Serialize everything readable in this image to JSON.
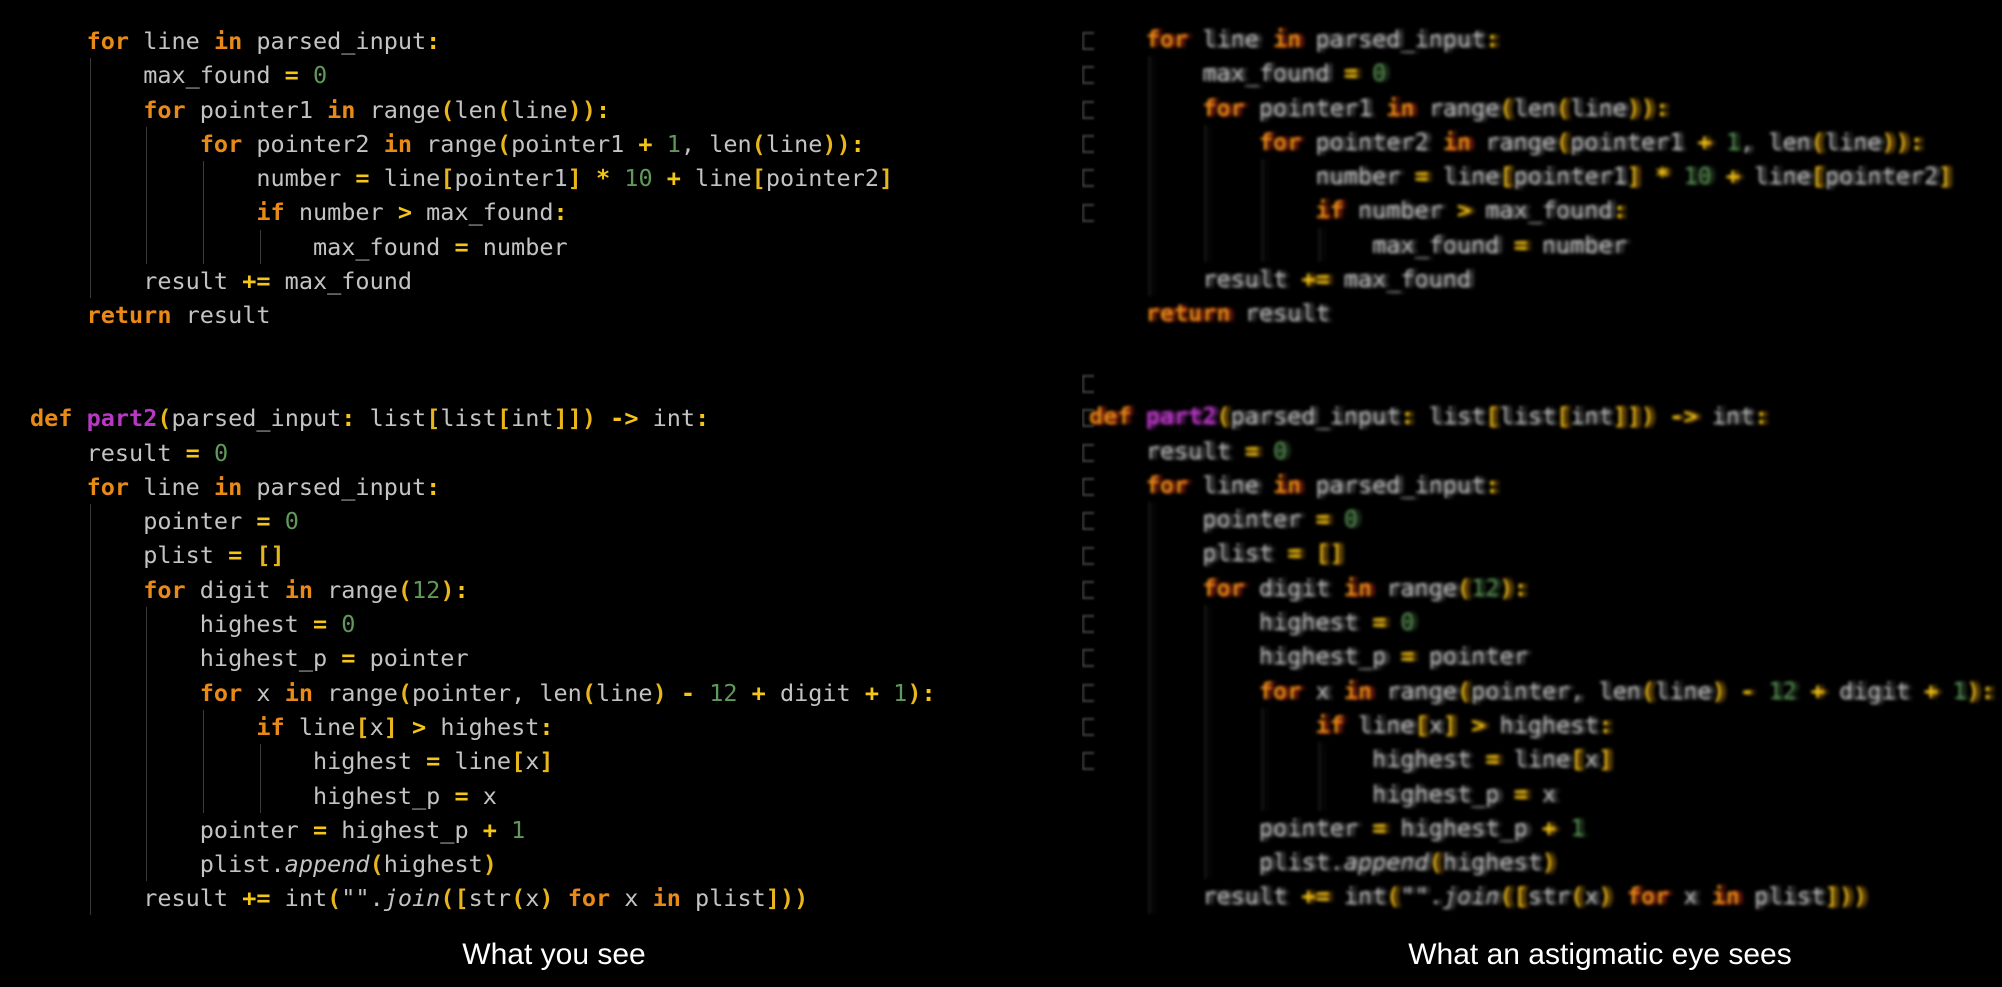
{
  "captions": {
    "left": "What you see",
    "right": "What an astigmatic eye sees"
  },
  "colors": {
    "background": "#000000",
    "default_text": "#c3c3c3",
    "keyword": "#e98a17",
    "operator": "#f5c518",
    "number": "#5f9a5a",
    "function_name": "#b838c4",
    "bracket": "#e8b51a",
    "indent_guide": "#3a3a3a"
  },
  "code_lines": [
    {
      "indent": 1,
      "tokens": [
        [
          "kw",
          "for"
        ],
        [
          "t",
          " line "
        ],
        [
          "kw",
          "in"
        ],
        [
          "t",
          " parsed_input"
        ],
        [
          "op",
          ":"
        ]
      ]
    },
    {
      "indent": 2,
      "tokens": [
        [
          "t",
          "max_found "
        ],
        [
          "op",
          "="
        ],
        [
          "t",
          " "
        ],
        [
          "num",
          "0"
        ]
      ]
    },
    {
      "indent": 2,
      "tokens": [
        [
          "kw",
          "for"
        ],
        [
          "t",
          " pointer1 "
        ],
        [
          "kw",
          "in"
        ],
        [
          "t",
          " range"
        ],
        [
          "br",
          "("
        ],
        [
          "t",
          "len"
        ],
        [
          "br",
          "("
        ],
        [
          "t",
          "line"
        ],
        [
          "br",
          "))"
        ],
        [
          "op",
          ":"
        ]
      ]
    },
    {
      "indent": 3,
      "tokens": [
        [
          "kw",
          "for"
        ],
        [
          "t",
          " pointer2 "
        ],
        [
          "kw",
          "in"
        ],
        [
          "t",
          " range"
        ],
        [
          "br",
          "("
        ],
        [
          "t",
          "pointer1 "
        ],
        [
          "op",
          "+"
        ],
        [
          "t",
          " "
        ],
        [
          "num",
          "1"
        ],
        [
          "t",
          ", len"
        ],
        [
          "br",
          "("
        ],
        [
          "t",
          "line"
        ],
        [
          "br",
          "))"
        ],
        [
          "op",
          ":"
        ]
      ]
    },
    {
      "indent": 4,
      "tokens": [
        [
          "t",
          "number "
        ],
        [
          "op",
          "="
        ],
        [
          "t",
          " line"
        ],
        [
          "br",
          "["
        ],
        [
          "t",
          "pointer1"
        ],
        [
          "br",
          "]"
        ],
        [
          "t",
          " "
        ],
        [
          "op",
          "*"
        ],
        [
          "t",
          " "
        ],
        [
          "num",
          "10"
        ],
        [
          "t",
          " "
        ],
        [
          "op",
          "+"
        ],
        [
          "t",
          " line"
        ],
        [
          "br",
          "["
        ],
        [
          "t",
          "pointer2"
        ],
        [
          "br",
          "]"
        ]
      ]
    },
    {
      "indent": 4,
      "tokens": [
        [
          "kw",
          "if"
        ],
        [
          "t",
          " number "
        ],
        [
          "op",
          ">"
        ],
        [
          "t",
          " max_found"
        ],
        [
          "op",
          ":"
        ]
      ]
    },
    {
      "indent": 5,
      "tokens": [
        [
          "t",
          "max_found "
        ],
        [
          "op",
          "="
        ],
        [
          "t",
          " number"
        ]
      ]
    },
    {
      "indent": 2,
      "tokens": [
        [
          "t",
          "result "
        ],
        [
          "op",
          "+="
        ],
        [
          "t",
          " max_found"
        ]
      ]
    },
    {
      "indent": 1,
      "tokens": [
        [
          "kw",
          "return"
        ],
        [
          "t",
          " result"
        ]
      ]
    },
    {
      "indent": 0,
      "tokens": []
    },
    {
      "indent": 0,
      "tokens": []
    },
    {
      "indent": 0,
      "tokens": [
        [
          "kw",
          "def"
        ],
        [
          "t",
          " "
        ],
        [
          "fn",
          "part2"
        ],
        [
          "br",
          "("
        ],
        [
          "t",
          "parsed_input"
        ],
        [
          "op",
          ":"
        ],
        [
          "t",
          " list"
        ],
        [
          "br",
          "["
        ],
        [
          "t",
          "list"
        ],
        [
          "br",
          "["
        ],
        [
          "t",
          "int"
        ],
        [
          "br",
          "]])"
        ],
        [
          "t",
          " "
        ],
        [
          "op",
          "->"
        ],
        [
          "t",
          " int"
        ],
        [
          "op",
          ":"
        ]
      ]
    },
    {
      "indent": 1,
      "tokens": [
        [
          "t",
          "result "
        ],
        [
          "op",
          "="
        ],
        [
          "t",
          " "
        ],
        [
          "num",
          "0"
        ]
      ]
    },
    {
      "indent": 1,
      "tokens": [
        [
          "kw",
          "for"
        ],
        [
          "t",
          " line "
        ],
        [
          "kw",
          "in"
        ],
        [
          "t",
          " parsed_input"
        ],
        [
          "op",
          ":"
        ]
      ]
    },
    {
      "indent": 2,
      "tokens": [
        [
          "t",
          "pointer "
        ],
        [
          "op",
          "="
        ],
        [
          "t",
          " "
        ],
        [
          "num",
          "0"
        ]
      ]
    },
    {
      "indent": 2,
      "tokens": [
        [
          "t",
          "plist "
        ],
        [
          "op",
          "="
        ],
        [
          "t",
          " "
        ],
        [
          "br",
          "[]"
        ]
      ]
    },
    {
      "indent": 2,
      "tokens": [
        [
          "kw",
          "for"
        ],
        [
          "t",
          " digit "
        ],
        [
          "kw",
          "in"
        ],
        [
          "t",
          " range"
        ],
        [
          "br",
          "("
        ],
        [
          "num",
          "12"
        ],
        [
          "br",
          ")"
        ],
        [
          "op",
          ":"
        ]
      ]
    },
    {
      "indent": 3,
      "tokens": [
        [
          "t",
          "highest "
        ],
        [
          "op",
          "="
        ],
        [
          "t",
          " "
        ],
        [
          "num",
          "0"
        ]
      ]
    },
    {
      "indent": 3,
      "tokens": [
        [
          "t",
          "highest_p "
        ],
        [
          "op",
          "="
        ],
        [
          "t",
          " pointer"
        ]
      ]
    },
    {
      "indent": 3,
      "tokens": [
        [
          "kw",
          "for"
        ],
        [
          "t",
          " x "
        ],
        [
          "kw",
          "in"
        ],
        [
          "t",
          " range"
        ],
        [
          "br",
          "("
        ],
        [
          "t",
          "pointer, len"
        ],
        [
          "br",
          "("
        ],
        [
          "t",
          "line"
        ],
        [
          "br",
          ")"
        ],
        [
          "t",
          " "
        ],
        [
          "op",
          "-"
        ],
        [
          "t",
          " "
        ],
        [
          "num",
          "12"
        ],
        [
          "t",
          " "
        ],
        [
          "op",
          "+"
        ],
        [
          "t",
          " digit "
        ],
        [
          "op",
          "+"
        ],
        [
          "t",
          " "
        ],
        [
          "num",
          "1"
        ],
        [
          "br",
          ")"
        ],
        [
          "op",
          ":"
        ]
      ]
    },
    {
      "indent": 4,
      "tokens": [
        [
          "kw",
          "if"
        ],
        [
          "t",
          " line"
        ],
        [
          "br",
          "["
        ],
        [
          "t",
          "x"
        ],
        [
          "br",
          "]"
        ],
        [
          "t",
          " "
        ],
        [
          "op",
          ">"
        ],
        [
          "t",
          " highest"
        ],
        [
          "op",
          ":"
        ]
      ]
    },
    {
      "indent": 5,
      "tokens": [
        [
          "t",
          "highest "
        ],
        [
          "op",
          "="
        ],
        [
          "t",
          " line"
        ],
        [
          "br",
          "["
        ],
        [
          "t",
          "x"
        ],
        [
          "br",
          "]"
        ]
      ]
    },
    {
      "indent": 5,
      "tokens": [
        [
          "t",
          "highest_p "
        ],
        [
          "op",
          "="
        ],
        [
          "t",
          " x"
        ]
      ]
    },
    {
      "indent": 3,
      "tokens": [
        [
          "t",
          "pointer "
        ],
        [
          "op",
          "="
        ],
        [
          "t",
          " highest_p "
        ],
        [
          "op",
          "+"
        ],
        [
          "t",
          " "
        ],
        [
          "num",
          "1"
        ]
      ]
    },
    {
      "indent": 3,
      "tokens": [
        [
          "t",
          "plist."
        ],
        [
          "it",
          "append"
        ],
        [
          "br",
          "("
        ],
        [
          "t",
          "highest"
        ],
        [
          "br",
          ")"
        ]
      ]
    },
    {
      "indent": 2,
      "tokens": [
        [
          "t",
          "result "
        ],
        [
          "op",
          "+="
        ],
        [
          "t",
          " int"
        ],
        [
          "br",
          "("
        ],
        [
          "t",
          "\"\"."
        ],
        [
          "it",
          "join"
        ],
        [
          "br",
          "(["
        ],
        [
          "t",
          "str"
        ],
        [
          "br",
          "("
        ],
        [
          "t",
          "x"
        ],
        [
          "br",
          ")"
        ],
        [
          "t",
          " "
        ],
        [
          "kw",
          "for"
        ],
        [
          "t",
          " x "
        ],
        [
          "kw",
          "in"
        ],
        [
          "t",
          " plist"
        ],
        [
          "br",
          "]))"
        ]
      ]
    }
  ]
}
